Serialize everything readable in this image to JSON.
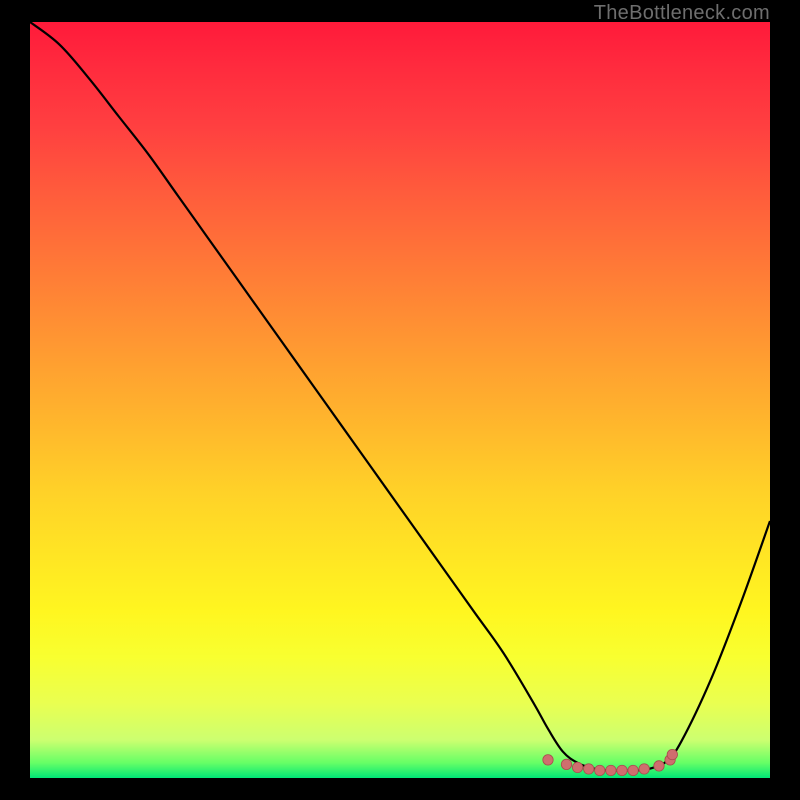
{
  "watermark": "TheBottleneck.com",
  "colors": {
    "page_bg": "#000000",
    "curve_stroke": "#000000",
    "marker_fill": "#cf6e6e",
    "marker_stroke": "#a84d4d"
  },
  "chart_data": {
    "type": "line",
    "title": "",
    "xlabel": "",
    "ylabel": "",
    "xlim": [
      0,
      100
    ],
    "ylim": [
      0,
      100
    ],
    "grid": false,
    "series": [
      {
        "name": "bottleneck-curve",
        "x": [
          0,
          4,
          8,
          12,
          16,
          20,
          24,
          28,
          32,
          36,
          40,
          44,
          48,
          52,
          56,
          60,
          64,
          68,
          70,
          72,
          74,
          76,
          78,
          80,
          82,
          84,
          86,
          88,
          92,
          96,
          100
        ],
        "y": [
          100,
          97,
          92.5,
          87.5,
          82.5,
          77,
          71.5,
          66,
          60.5,
          55,
          49.5,
          44,
          38.5,
          33,
          27.5,
          22,
          16.5,
          10,
          6.5,
          3.5,
          2.0,
          1.3,
          1.0,
          1.0,
          1.0,
          1.3,
          2.2,
          4.8,
          13,
          23,
          34
        ]
      }
    ],
    "markers": {
      "name": "highlight-points",
      "x": [
        70.0,
        72.5,
        74.0,
        75.5,
        77.0,
        78.5,
        80.0,
        81.5,
        83.0,
        85.0,
        86.5,
        86.8
      ],
      "y": [
        2.4,
        1.8,
        1.4,
        1.2,
        1.0,
        1.0,
        1.0,
        1.0,
        1.2,
        1.6,
        2.4,
        3.1
      ]
    }
  }
}
